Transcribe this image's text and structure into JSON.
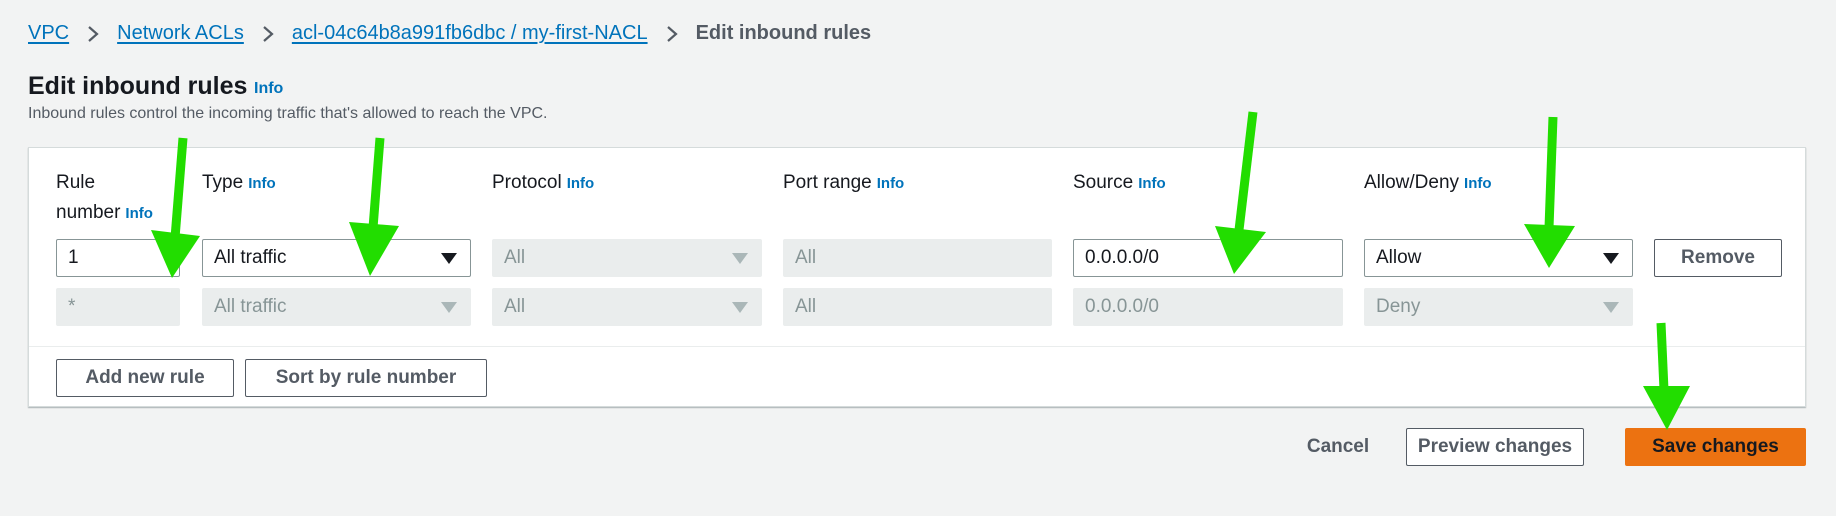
{
  "breadcrumb": {
    "items": [
      "VPC",
      "Network ACLs",
      "acl-04c64b8a991fb6dbc / my-first-NACL"
    ],
    "current": "Edit inbound rules"
  },
  "header": {
    "title": "Edit inbound rules",
    "info": "Info",
    "description": "Inbound rules control the incoming traffic that's allowed to reach the VPC."
  },
  "table": {
    "columns": {
      "rule_number_line1": "Rule",
      "rule_number_line2": "number",
      "type": "Type",
      "protocol": "Protocol",
      "port_range": "Port range",
      "source": "Source",
      "allow_deny": "Allow/Deny",
      "info": "Info"
    },
    "rows": [
      {
        "rule_number": "1",
        "type": "All traffic",
        "protocol": "All",
        "port_range": "All",
        "source": "0.0.0.0/0",
        "allow_deny": "Allow",
        "remove_label": "Remove"
      },
      {
        "rule_number": "*",
        "type": "All traffic",
        "protocol": "All",
        "port_range": "All",
        "source": "0.0.0.0/0",
        "allow_deny": "Deny"
      }
    ],
    "add_rule_label": "Add new rule",
    "sort_label": "Sort by rule number"
  },
  "footer": {
    "cancel_label": "Cancel",
    "preview_label": "Preview changes",
    "save_label": "Save changes"
  },
  "colors": {
    "link": "#0073bb",
    "primary_button": "#ec7211",
    "annotation_arrow": "#22dd00",
    "background": "#f2f3f3"
  },
  "icons": {
    "breadcrumb_separator": "chevron-right-icon",
    "dropdown": "caret-down-icon",
    "annotation": "arrow-down-icon"
  }
}
